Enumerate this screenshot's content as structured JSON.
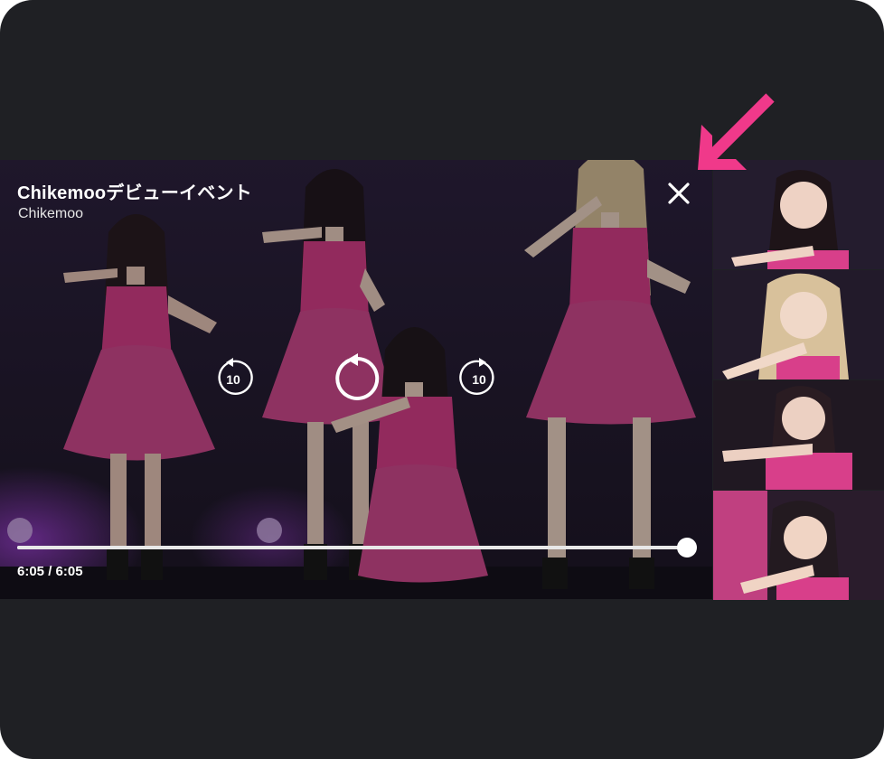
{
  "video": {
    "title": "Chikemooデビューイベント",
    "channel": "Chikemoo",
    "time_display": "6:05 / 6:05",
    "progress_fraction": 1.0
  },
  "controls": {
    "rewind_seconds": "10",
    "forward_seconds": "10",
    "rewind_icon": "rewind-10-icon",
    "replay_icon": "replay-icon",
    "forward_icon": "forward-10-icon",
    "close_icon": "close-icon"
  },
  "thumbnails": [
    {
      "name": "thumbnail-1",
      "icon": "video-thumbnail"
    },
    {
      "name": "thumbnail-2",
      "icon": "video-thumbnail"
    },
    {
      "name": "thumbnail-3",
      "icon": "video-thumbnail"
    },
    {
      "name": "thumbnail-4",
      "icon": "video-thumbnail"
    }
  ],
  "annotation": {
    "arrow_color": "#f0398a",
    "icon": "arrow-pointer-icon"
  },
  "colors": {
    "background": "#1f2024",
    "dress_pink": "#d83f8a",
    "stage_purple": "#2a1e3a"
  }
}
